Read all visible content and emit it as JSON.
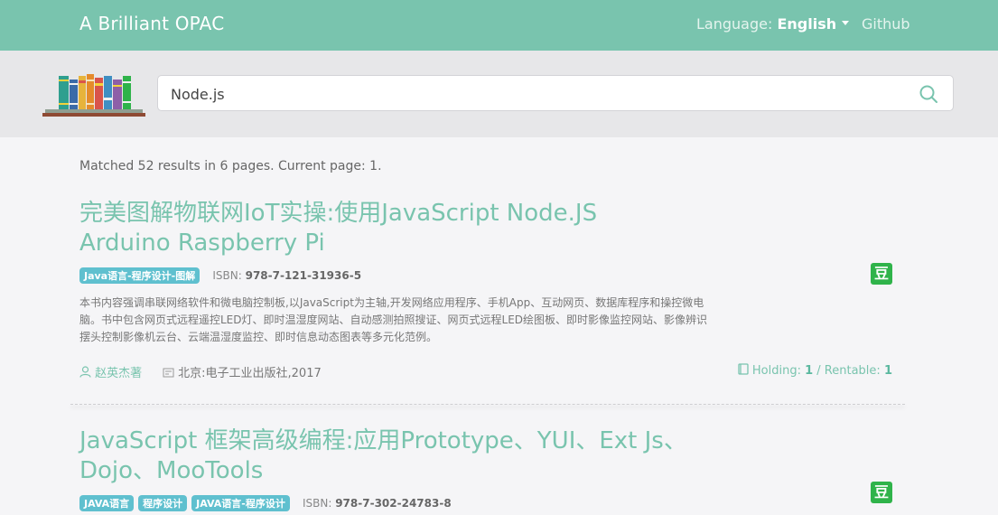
{
  "navbar": {
    "brand": "A Brilliant OPAC",
    "language_label": "Language:",
    "language_value": "English",
    "github": "Github"
  },
  "search": {
    "value": "Node.js",
    "placeholder": ""
  },
  "summary": "Matched 52 results in 6 pages. Current page: 1.",
  "results": [
    {
      "title": "完美图解物联网IoT实操:使用JavaScript Node.JS Arduino Raspberry Pi",
      "tags": [
        "Java语言-程序设计-图解"
      ],
      "isbn_label": "ISBN:",
      "isbn": "978-7-121-31936-5",
      "douban": "豆",
      "description": "本书内容强调串联网络软件和微电脑控制板,以JavaScript为主轴,开发网络应用程序、手机App、互动网页、数据库程序和操控微电脑。书中包含网页式远程遥控LED灯、即时温湿度网站、自动感测拍照搜证、网页式远程LED绘图板、即时影像监控网站、影像辨识摆头控制影像机云台、云端温湿度监控、即时信息动态图表等多元化范例。",
      "author": "赵英杰著",
      "publisher": "北京:电子工业出版社,2017",
      "holding_label": "Holding:",
      "holding": "1",
      "rentable_label": "/ Rentable:",
      "rentable": "1"
    },
    {
      "title": "JavaScript 框架高级编程:应用Prototype、YUI、Ext Js、Dojo、MooTools",
      "tags": [
        "JAVA语言",
        "程序设计",
        "JAVA语言-程序设计"
      ],
      "isbn_label": "ISBN:",
      "isbn": "978-7-302-24783-8",
      "douban": "豆"
    }
  ],
  "icons": {
    "search": "search-icon",
    "author": "user-icon",
    "publisher": "publisher-icon",
    "holding": "book-icon",
    "douban": "douban-icon"
  },
  "colors": {
    "brand": "#79c4ae",
    "tag": "#5fc0cf",
    "douban": "#2fb34a",
    "background": "#f5f5f7"
  }
}
